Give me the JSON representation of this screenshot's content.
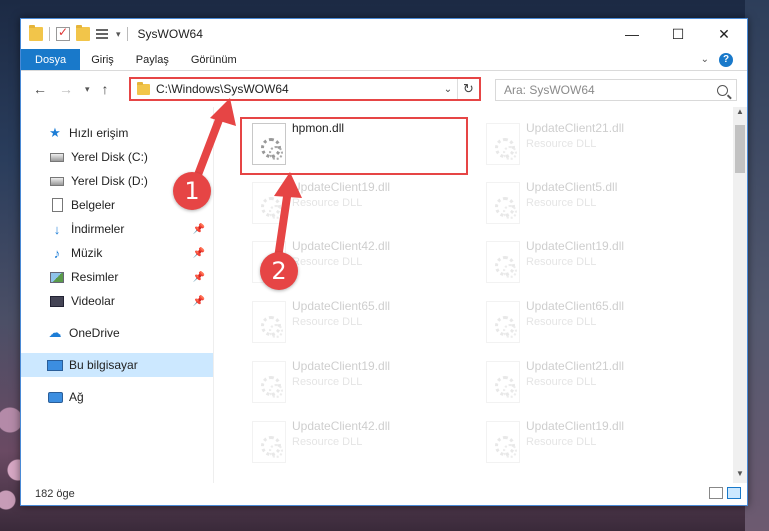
{
  "window": {
    "title": "SysWOW64"
  },
  "ribbon": {
    "tabs": [
      {
        "label": "Dosya"
      },
      {
        "label": "Giriş"
      },
      {
        "label": "Paylaş"
      },
      {
        "label": "Görünüm"
      }
    ],
    "help_label": "?"
  },
  "address": {
    "path": "C:\\Windows\\SysWOW64",
    "refresh_label": "↻",
    "dropdown_label": "⌄"
  },
  "search": {
    "placeholder": "Ara: SysWOW64"
  },
  "sidebar": {
    "items": [
      {
        "label": "Hızlı erişim",
        "icon": "star-icon"
      },
      {
        "label": "Yerel Disk (C:)",
        "icon": "disk-icon"
      },
      {
        "label": "Yerel Disk (D:)",
        "icon": "disk-icon"
      },
      {
        "label": "Belgeler",
        "icon": "documents-icon"
      },
      {
        "label": "İndirmeler",
        "icon": "download-icon"
      },
      {
        "label": "Müzik",
        "icon": "music-icon"
      },
      {
        "label": "Resimler",
        "icon": "pictures-icon"
      },
      {
        "label": "Videolar",
        "icon": "videos-icon"
      },
      {
        "label": "OneDrive",
        "icon": "cloud-icon"
      },
      {
        "label": "Bu bilgisayar",
        "icon": "computer-icon"
      },
      {
        "label": "Ağ",
        "icon": "network-icon"
      }
    ]
  },
  "files": {
    "highlighted": {
      "name": "hpmon.dll"
    },
    "faded": [
      {
        "name": "UpdateClient21.dll",
        "type": "Resource DLL"
      },
      {
        "name": "UpdateClient19.dll",
        "type": "Resource DLL"
      },
      {
        "name": "UpdateClient5.dll",
        "type": "Resource DLL"
      },
      {
        "name": "UpdateClient42.dll",
        "type": "Resource DLL"
      },
      {
        "name": "UpdateClient19.dll",
        "type": "Resource DLL"
      },
      {
        "name": "UpdateClient65.dll",
        "type": "Resource DLL"
      },
      {
        "name": "UpdateClient65.dll",
        "type": "Resource DLL"
      },
      {
        "name": "UpdateClient19.dll",
        "type": "Resource DLL"
      },
      {
        "name": "UpdateClient21.dll",
        "type": "Resource DLL"
      },
      {
        "name": "UpdateClient42.dll",
        "type": "Resource DLL"
      },
      {
        "name": "UpdateClient19.dll",
        "type": "Resource DLL"
      }
    ]
  },
  "status": {
    "item_count": "182 öge"
  },
  "annotations": {
    "step1": "1",
    "step2": "2",
    "color": "#e64545"
  }
}
